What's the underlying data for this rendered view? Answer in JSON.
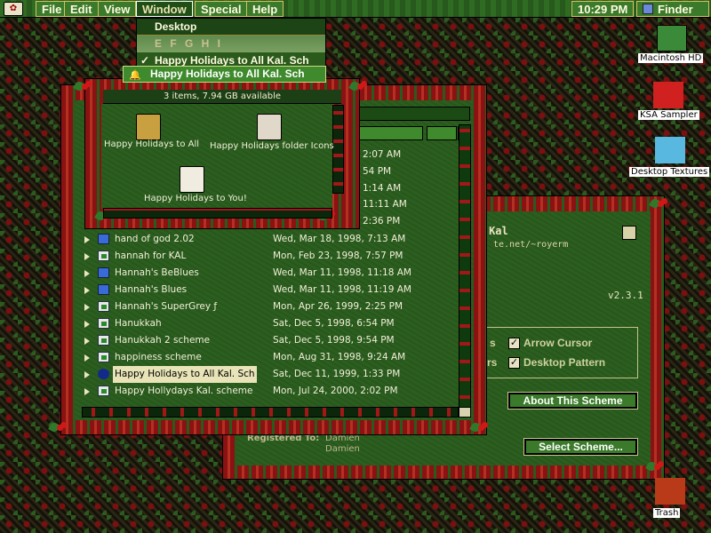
{
  "menubar": {
    "apple": "✿",
    "items": [
      "File",
      "Edit",
      "View",
      "Window",
      "Special",
      "Help"
    ],
    "clock": "10:29 PM",
    "app": "Finder"
  },
  "window_menu": {
    "items": [
      {
        "label": "Desktop",
        "checked": false
      },
      {
        "label": "E F G H I",
        "checked": false
      },
      {
        "label": "Happy Holidays to All Kal. Sch",
        "checked": true
      },
      {
        "label": "Happy Holidays to All Kal. Sch",
        "highlighted": true
      }
    ]
  },
  "list_window": {
    "partial_times": [
      "2:07 AM",
      "54 PM",
      "1:14 AM",
      "11:11 AM",
      "2:36 PM"
    ],
    "rows": [
      {
        "name": "hand of god 2.02",
        "date": "Wed, Mar 18, 1998, 7:13 AM",
        "icon": "folder"
      },
      {
        "name": "hannah for KAL",
        "date": "Mon, Feb 23, 1998, 7:57 PM",
        "icon": "doc"
      },
      {
        "name": "Hannah's BeBlues",
        "date": "Wed, Mar 11, 1998, 11:18 AM",
        "icon": "folder"
      },
      {
        "name": "Hannah's Blues",
        "date": "Wed, Mar 11, 1998, 11:19 AM",
        "icon": "folder"
      },
      {
        "name": "Hannah's SuperGrey ƒ",
        "date": "Mon, Apr 26, 1999, 2:25 PM",
        "icon": "doc"
      },
      {
        "name": "Hanukkah",
        "date": "Sat, Dec 5, 1998, 6:54 PM",
        "icon": "doc"
      },
      {
        "name": "Hanukkah 2 scheme",
        "date": "Sat, Dec 5, 1998, 9:54 PM",
        "icon": "doc"
      },
      {
        "name": "happiness scheme",
        "date": "Mon, Aug 31, 1998, 9:24 AM",
        "icon": "doc"
      },
      {
        "name": "Happy Holidays to All Kal. Sch",
        "date": "Sat, Dec 11, 1999, 1:33 PM",
        "icon": "dark",
        "selected": true
      },
      {
        "name": "Happy Hollydays Kal. scheme",
        "date": "Mon, Jul 24, 2000, 2:02 PM",
        "icon": "doc"
      }
    ]
  },
  "folder_window": {
    "info": "3 items, 7.94 GB available",
    "items": [
      {
        "label": "Happy Holidays to All",
        "color": "#c8a040"
      },
      {
        "label": "Happy Holidays folder Icons",
        "color": "#e0d8c8"
      },
      {
        "label": "Happy Holidays to You!",
        "color": "#f0ece0"
      }
    ]
  },
  "ksa_window": {
    "title_text": "ppy Holidays to all from Martha for Kal",
    "url": "te.net/~royerm",
    "version": "v2.3.1",
    "options": [
      {
        "label": "Arrow Cursor",
        "checked": true,
        "prefix": "s"
      },
      {
        "label": "Desktop Pattern",
        "checked": true,
        "prefix": "rs"
      }
    ],
    "about_button": "About This Scheme",
    "select_button": "Select Scheme...",
    "registered_label": "Registered To:",
    "registered_name": "Damien",
    "registered_name2": "Damien"
  },
  "desktop": {
    "icons": [
      {
        "label": "Macintosh HD",
        "color": "#3a8a3a"
      },
      {
        "label": "KSA Sampler",
        "color": "#d02020"
      },
      {
        "label": "Desktop Textures",
        "color": "#58b8e0"
      },
      {
        "label": "Trash",
        "color": "#b83a18"
      }
    ]
  }
}
